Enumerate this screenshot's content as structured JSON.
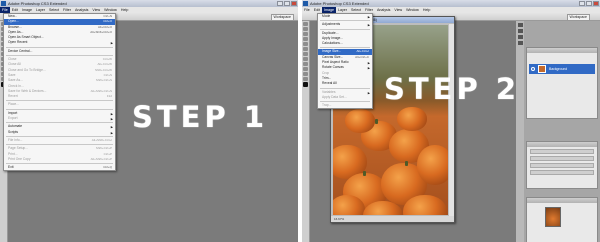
{
  "panel1": {
    "title": "Adobe Photoshop CS3 Extended",
    "menubar": [
      "File",
      "Edit",
      "Image",
      "Layer",
      "Select",
      "Filter",
      "Analysis",
      "View",
      "Window",
      "Help"
    ],
    "workspace_label": "Workspace",
    "file_menu": [
      {
        "label": "New...",
        "shortcut": "Ctrl+N",
        "disabled": false
      },
      {
        "label": "Open...",
        "shortcut": "Ctrl+O",
        "disabled": false,
        "highlight": true
      },
      {
        "label": "Browse...",
        "shortcut": "Alt+Ctrl+O",
        "disabled": false
      },
      {
        "label": "Open As...",
        "shortcut": "Alt+Shift+Ctrl+O",
        "disabled": false
      },
      {
        "label": "Open As Smart Object...",
        "shortcut": "",
        "disabled": false
      },
      {
        "label": "Open Recent",
        "shortcut": "",
        "disabled": false,
        "submenu": true
      },
      {
        "sep": true
      },
      {
        "label": "Device Central...",
        "shortcut": "",
        "disabled": false
      },
      {
        "sep": true
      },
      {
        "label": "Close",
        "shortcut": "Ctrl+W",
        "disabled": true
      },
      {
        "label": "Close All",
        "shortcut": "Alt+Ctrl+W",
        "disabled": true
      },
      {
        "label": "Close and Go To Bridge...",
        "shortcut": "Shift+Ctrl+W",
        "disabled": true
      },
      {
        "label": "Save",
        "shortcut": "Ctrl+S",
        "disabled": true
      },
      {
        "label": "Save As...",
        "shortcut": "Shift+Ctrl+S",
        "disabled": true
      },
      {
        "label": "Check In...",
        "shortcut": "",
        "disabled": true
      },
      {
        "label": "Save for Web & Devices...",
        "shortcut": "Alt+Shift+Ctrl+S",
        "disabled": true
      },
      {
        "label": "Revert",
        "shortcut": "F12",
        "disabled": true
      },
      {
        "sep": true
      },
      {
        "label": "Place...",
        "shortcut": "",
        "disabled": true
      },
      {
        "sep": true
      },
      {
        "label": "Import",
        "shortcut": "",
        "disabled": false,
        "submenu": true
      },
      {
        "label": "Export",
        "shortcut": "",
        "disabled": true,
        "submenu": true
      },
      {
        "sep": true
      },
      {
        "label": "Automate",
        "shortcut": "",
        "disabled": false,
        "submenu": true
      },
      {
        "label": "Scripts",
        "shortcut": "",
        "disabled": false,
        "submenu": true
      },
      {
        "sep": true
      },
      {
        "label": "File Info...",
        "shortcut": "Alt+Shift+Ctrl+I",
        "disabled": true
      },
      {
        "sep": true
      },
      {
        "label": "Page Setup...",
        "shortcut": "Shift+Ctrl+P",
        "disabled": true
      },
      {
        "label": "Print...",
        "shortcut": "Ctrl+P",
        "disabled": true
      },
      {
        "label": "Print One Copy",
        "shortcut": "Alt+Shift+Ctrl+P",
        "disabled": true
      },
      {
        "sep": true
      },
      {
        "label": "Exit",
        "shortcut": "Ctrl+Q",
        "disabled": false
      }
    ],
    "step_text": "STEP 1"
  },
  "panel2": {
    "title": "Adobe Photoshop CS3 Extended",
    "menubar": [
      "File",
      "Edit",
      "Image",
      "Layer",
      "Select",
      "Filter",
      "Analysis",
      "View",
      "Window",
      "Help"
    ],
    "workspace_label": "Workspace",
    "image_menu": [
      {
        "label": "Mode",
        "shortcut": "",
        "submenu": true
      },
      {
        "sep": true
      },
      {
        "label": "Adjustments",
        "shortcut": "",
        "submenu": true
      },
      {
        "sep": true
      },
      {
        "label": "Duplicate...",
        "shortcut": ""
      },
      {
        "label": "Apply Image...",
        "shortcut": ""
      },
      {
        "label": "Calculations...",
        "shortcut": ""
      },
      {
        "sep": true
      },
      {
        "label": "Image Size...",
        "shortcut": "Alt+Ctrl+I",
        "highlight": true
      },
      {
        "label": "Canvas Size...",
        "shortcut": "Alt+Ctrl+C"
      },
      {
        "label": "Pixel Aspect Ratio",
        "shortcut": "",
        "submenu": true
      },
      {
        "label": "Rotate Canvas",
        "shortcut": "",
        "submenu": true
      },
      {
        "label": "Crop",
        "shortcut": "",
        "disabled": true
      },
      {
        "label": "Trim...",
        "shortcut": ""
      },
      {
        "label": "Reveal All",
        "shortcut": ""
      },
      {
        "sep": true
      },
      {
        "label": "Variables",
        "shortcut": "",
        "disabled": true,
        "submenu": true
      },
      {
        "label": "Apply Data Set...",
        "shortcut": "",
        "disabled": true
      },
      {
        "sep": true
      },
      {
        "label": "Trap...",
        "shortcut": "",
        "disabled": true
      }
    ],
    "document_title": "pumpkins @ 16.7% (RGB/8)",
    "document_status": "16.67%",
    "layer_name": "Background",
    "step_text": "STEP 2"
  }
}
